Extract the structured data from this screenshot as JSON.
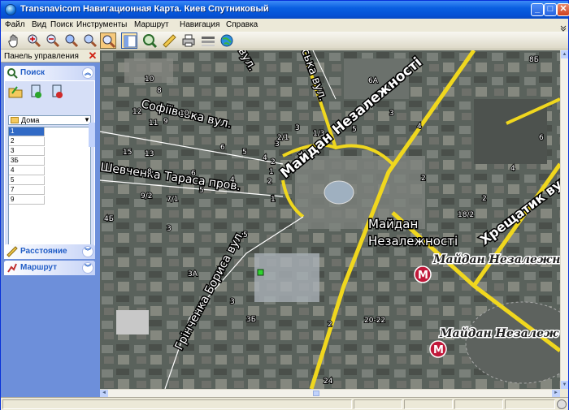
{
  "window": {
    "title": "Transnavicom Навигационная Карта. Киев Спутниковый",
    "min_label": "_",
    "max_label": "□",
    "close_label": "✕"
  },
  "menu": {
    "items": [
      "Файл",
      "Вид",
      "Поиск",
      "Инструменты",
      "Маршрут",
      "Навигация",
      "Справка"
    ]
  },
  "toolbar": {
    "icons": [
      "hand-pan-icon",
      "zoom-in-icon",
      "zoom-out-icon",
      "zoom-area-icon",
      "zoom-window-icon",
      "zoom-active-icon",
      "panel-toggle-icon",
      "find-icon",
      "ruler-icon",
      "print-icon",
      "layers-icon",
      "globe-icon"
    ]
  },
  "panel": {
    "title": "Панель управления",
    "close_label": "✕",
    "search": {
      "title": "Поиск",
      "collapse_label": "︽",
      "category": "Дома",
      "results": [
        "1",
        "2",
        "3",
        "3Б",
        "4",
        "5",
        "7",
        "9"
      ],
      "selected_index": 0
    },
    "distance": {
      "title": "Расстояние",
      "expand_label": "︾"
    },
    "route": {
      "title": "Маршрут",
      "expand_label": "︾"
    }
  },
  "map": {
    "streets": [
      "Софіївська вул.",
      "Шевченка Тараса пров.",
      "Майдан Незалежності",
      "Хрещатик вул.",
      "Грінченка Бориса вул.",
      "ська вул.",
      "вул."
    ],
    "place_label_line1": "Майдан",
    "place_label_line2": "Незалежності",
    "metro_labels": [
      "Майдан Незалежності",
      "Майдан Незалеж"
    ],
    "metro_letter": "M",
    "house_numbers": [
      "10",
      "8",
      "12",
      "11",
      "9",
      "10",
      "15",
      "13",
      "6",
      "5",
      "4",
      "3",
      "2",
      "2/1",
      "1",
      "3",
      "1/3",
      "6А",
      "3",
      "5",
      "4",
      "2",
      "8Б",
      "6",
      "4",
      "2",
      "18/2",
      "8",
      "6",
      "5",
      "4",
      "2",
      "1",
      "9/2",
      "7/1",
      "4Б",
      "3",
      "5",
      "3А",
      "3Б",
      "2",
      "20-22",
      "24",
      "3",
      "1",
      "4",
      "2"
    ],
    "colors": {
      "road": "#f0d71e",
      "metro": "#c0183a",
      "marker": "#2fd42f"
    }
  },
  "scroll": {
    "up": "▲",
    "down": "▼",
    "left": "◄",
    "right": "►"
  }
}
